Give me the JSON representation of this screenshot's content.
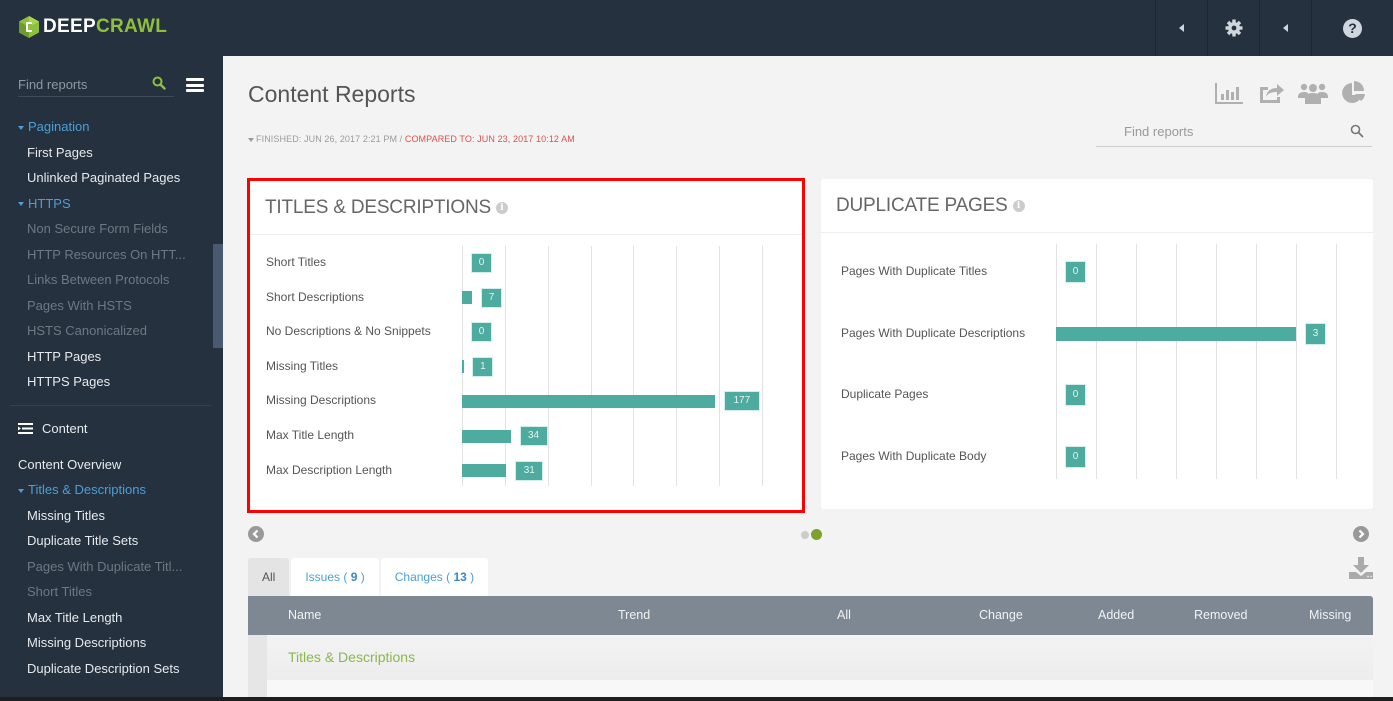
{
  "app": {
    "logo_part1": "DEEP",
    "logo_part2": "CRAWL"
  },
  "topbar": {
    "buttons": [
      {
        "icon": "caret-left-icon"
      },
      {
        "icon": "gear-icon"
      },
      {
        "icon": "caret-left-icon"
      },
      {
        "icon": "help-icon",
        "glyph": "?"
      }
    ]
  },
  "sidebar": {
    "search_placeholder": "Find reports",
    "groups_top": [
      {
        "label": "Pagination",
        "type": "group"
      },
      {
        "label": "First Pages",
        "type": "active"
      },
      {
        "label": "Unlinked Paginated Pages",
        "type": "active"
      },
      {
        "label": "HTTPS",
        "type": "group"
      },
      {
        "label": "Non Secure Form Fields",
        "type": "dim"
      },
      {
        "label": "HTTP Resources On HTT...",
        "type": "dim"
      },
      {
        "label": "Links Between Protocols",
        "type": "dim"
      },
      {
        "label": "Pages With HSTS",
        "type": "dim"
      },
      {
        "label": "HSTS Canonicalized",
        "type": "dim"
      },
      {
        "label": "HTTP Pages",
        "type": "active"
      },
      {
        "label": "HTTPS Pages",
        "type": "active"
      }
    ],
    "section_label": "Content",
    "groups_content": [
      {
        "label": "Content Overview",
        "type": "top"
      },
      {
        "label": "Titles & Descriptions",
        "type": "group"
      },
      {
        "label": "Missing Titles",
        "type": "active"
      },
      {
        "label": "Duplicate Title Sets",
        "type": "active"
      },
      {
        "label": "Pages With Duplicate Titl...",
        "type": "dim"
      },
      {
        "label": "Short Titles",
        "type": "dim"
      },
      {
        "label": "Max Title Length",
        "type": "active"
      },
      {
        "label": "Missing Descriptions",
        "type": "active"
      },
      {
        "label": "Duplicate Description Sets",
        "type": "active"
      }
    ]
  },
  "main": {
    "title": "Content Reports",
    "finished": "FINISHED: JUN 26, 2017 2:21 PM / ",
    "compared": "COMPARED TO: JUN 23, 2017 10:12 AM",
    "search_placeholder": "Find reports",
    "header_icons": [
      "bar-chart-icon",
      "share-icon",
      "users-icon",
      "pie-chart-icon"
    ]
  },
  "colors": {
    "bar": "#4dab9f",
    "accent_green": "#8fc03d",
    "link_blue": "#4a9fd8",
    "highlight_red": "#ff0000",
    "compared_red": "#d9534f"
  },
  "chart_data": [
    {
      "type": "bar",
      "orientation": "horizontal",
      "title": "TITLES & DESCRIPTIONS",
      "categories": [
        "Short Titles",
        "Short Descriptions",
        "No Descriptions & No Snippets",
        "Missing Titles",
        "Missing Descriptions",
        "Max Title Length",
        "Max Description Length"
      ],
      "values": [
        0,
        7,
        0,
        1,
        177,
        34,
        31
      ],
      "xlim": [
        0,
        210
      ],
      "grid_step": 30,
      "grid": true,
      "highlighted": true
    },
    {
      "type": "bar",
      "orientation": "horizontal",
      "title": "DUPLICATE PAGES",
      "categories": [
        "Pages With Duplicate Titles",
        "Pages With Duplicate Descriptions",
        "Duplicate Pages",
        "Pages With Duplicate Body"
      ],
      "values": [
        0,
        3,
        0,
        0
      ],
      "xlim": [
        0,
        3.5
      ],
      "grid_step": 0.5,
      "grid": true,
      "highlighted": false
    }
  ],
  "carousel": {
    "pages": 2,
    "active_page": 2
  },
  "tabs": [
    {
      "label": "All",
      "count": null
    },
    {
      "label": "Issues",
      "count": "9"
    },
    {
      "label": "Changes",
      "count": "13"
    }
  ],
  "table": {
    "columns": [
      "Name",
      "Trend",
      "All",
      "Change",
      "Added",
      "Removed",
      "Missing"
    ],
    "group_row": "Titles & Descriptions"
  }
}
